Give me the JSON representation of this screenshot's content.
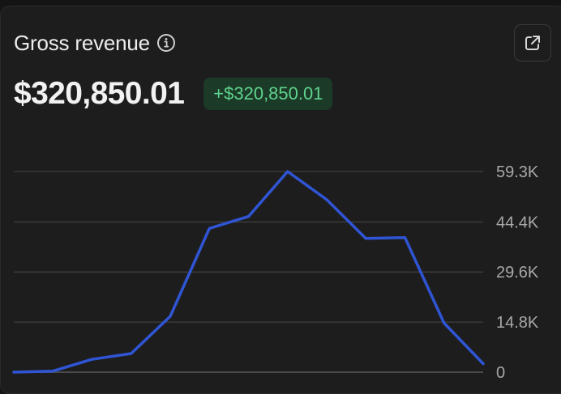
{
  "card": {
    "title": "Gross revenue",
    "value": "$320,850.01",
    "delta": "+$320,850.01"
  },
  "icons": {
    "info": "info-circle-icon",
    "external": "external-link-icon"
  },
  "colors": {
    "line": "#2f55d4",
    "delta_text": "#5fd38d",
    "delta_bg": "#1c3a28"
  },
  "chart_data": {
    "type": "line",
    "title": "",
    "xlabel": "",
    "ylabel": "",
    "y_ticks": [
      "0",
      "14.8K",
      "29.6K",
      "44.4K",
      "59.3K"
    ],
    "y_tick_values": [
      0,
      14800,
      29600,
      44400,
      59300
    ],
    "ylim": [
      0,
      59300
    ],
    "grid": true,
    "axis_position": "right",
    "series": [
      {
        "values": [
          0,
          300,
          3800,
          5500,
          16500,
          42500,
          46000,
          59300,
          51000,
          39500,
          39800,
          14500,
          2500
        ]
      }
    ]
  }
}
